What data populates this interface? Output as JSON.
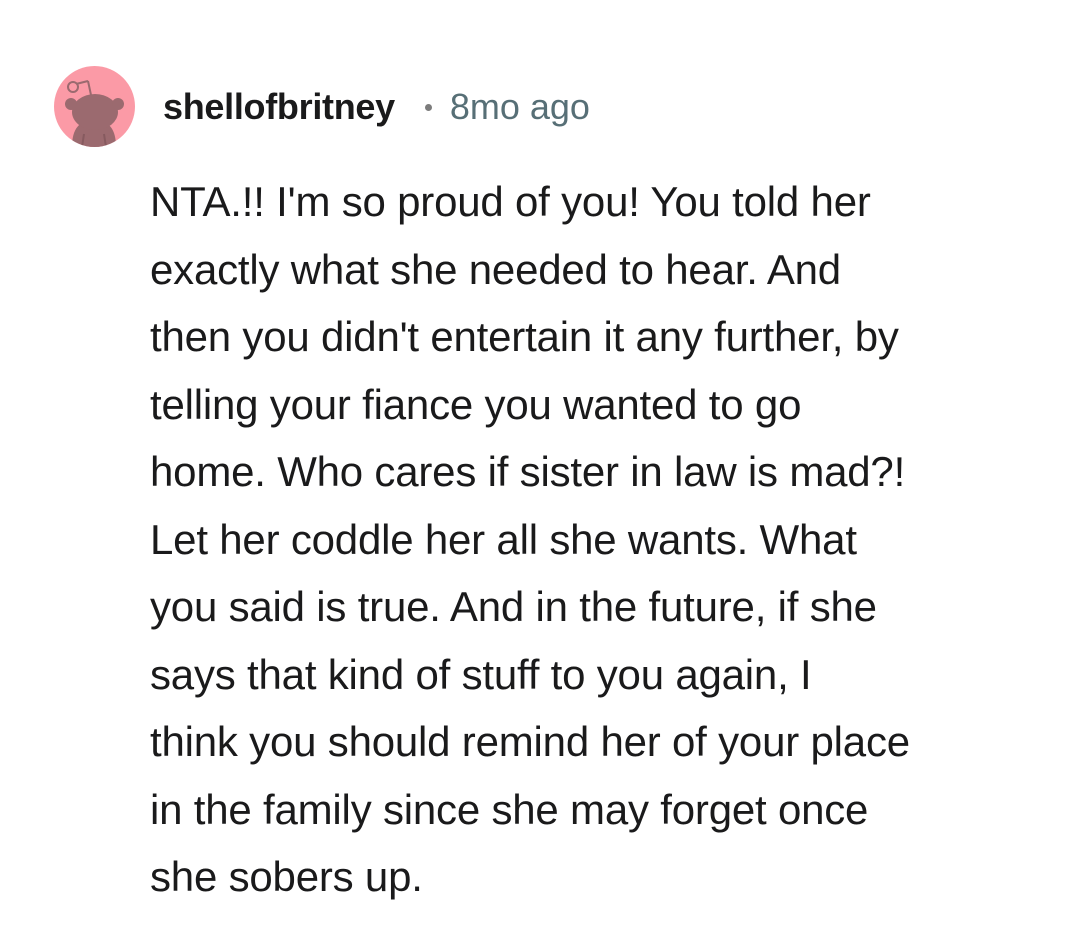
{
  "comment": {
    "author": "shellofbritney",
    "separator": "•",
    "timestamp": "8mo ago",
    "body_lines": [
      "NTA.!! I'm so proud of you! You told her",
      "exactly what she needed to hear. And",
      "then you didn't entertain it any further, by",
      "telling your fiance you wanted to go",
      "home. Who cares if sister in law is mad?!",
      "Let her coddle her all she wants. What",
      "you said is true. And in the future, if she",
      "says that kind of stuff to you again, I",
      "think you should remind her of your place",
      "in the family since she may forget once",
      "she sobers up."
    ]
  },
  "colors": {
    "avatar_background": "#fb9aa6",
    "avatar_figure": "#9b6a6f",
    "username": "#1a1a1b",
    "timestamp": "#576f76",
    "body_text": "#1a1a1b"
  },
  "icons": {
    "avatar": "snoo-avatar-icon"
  }
}
